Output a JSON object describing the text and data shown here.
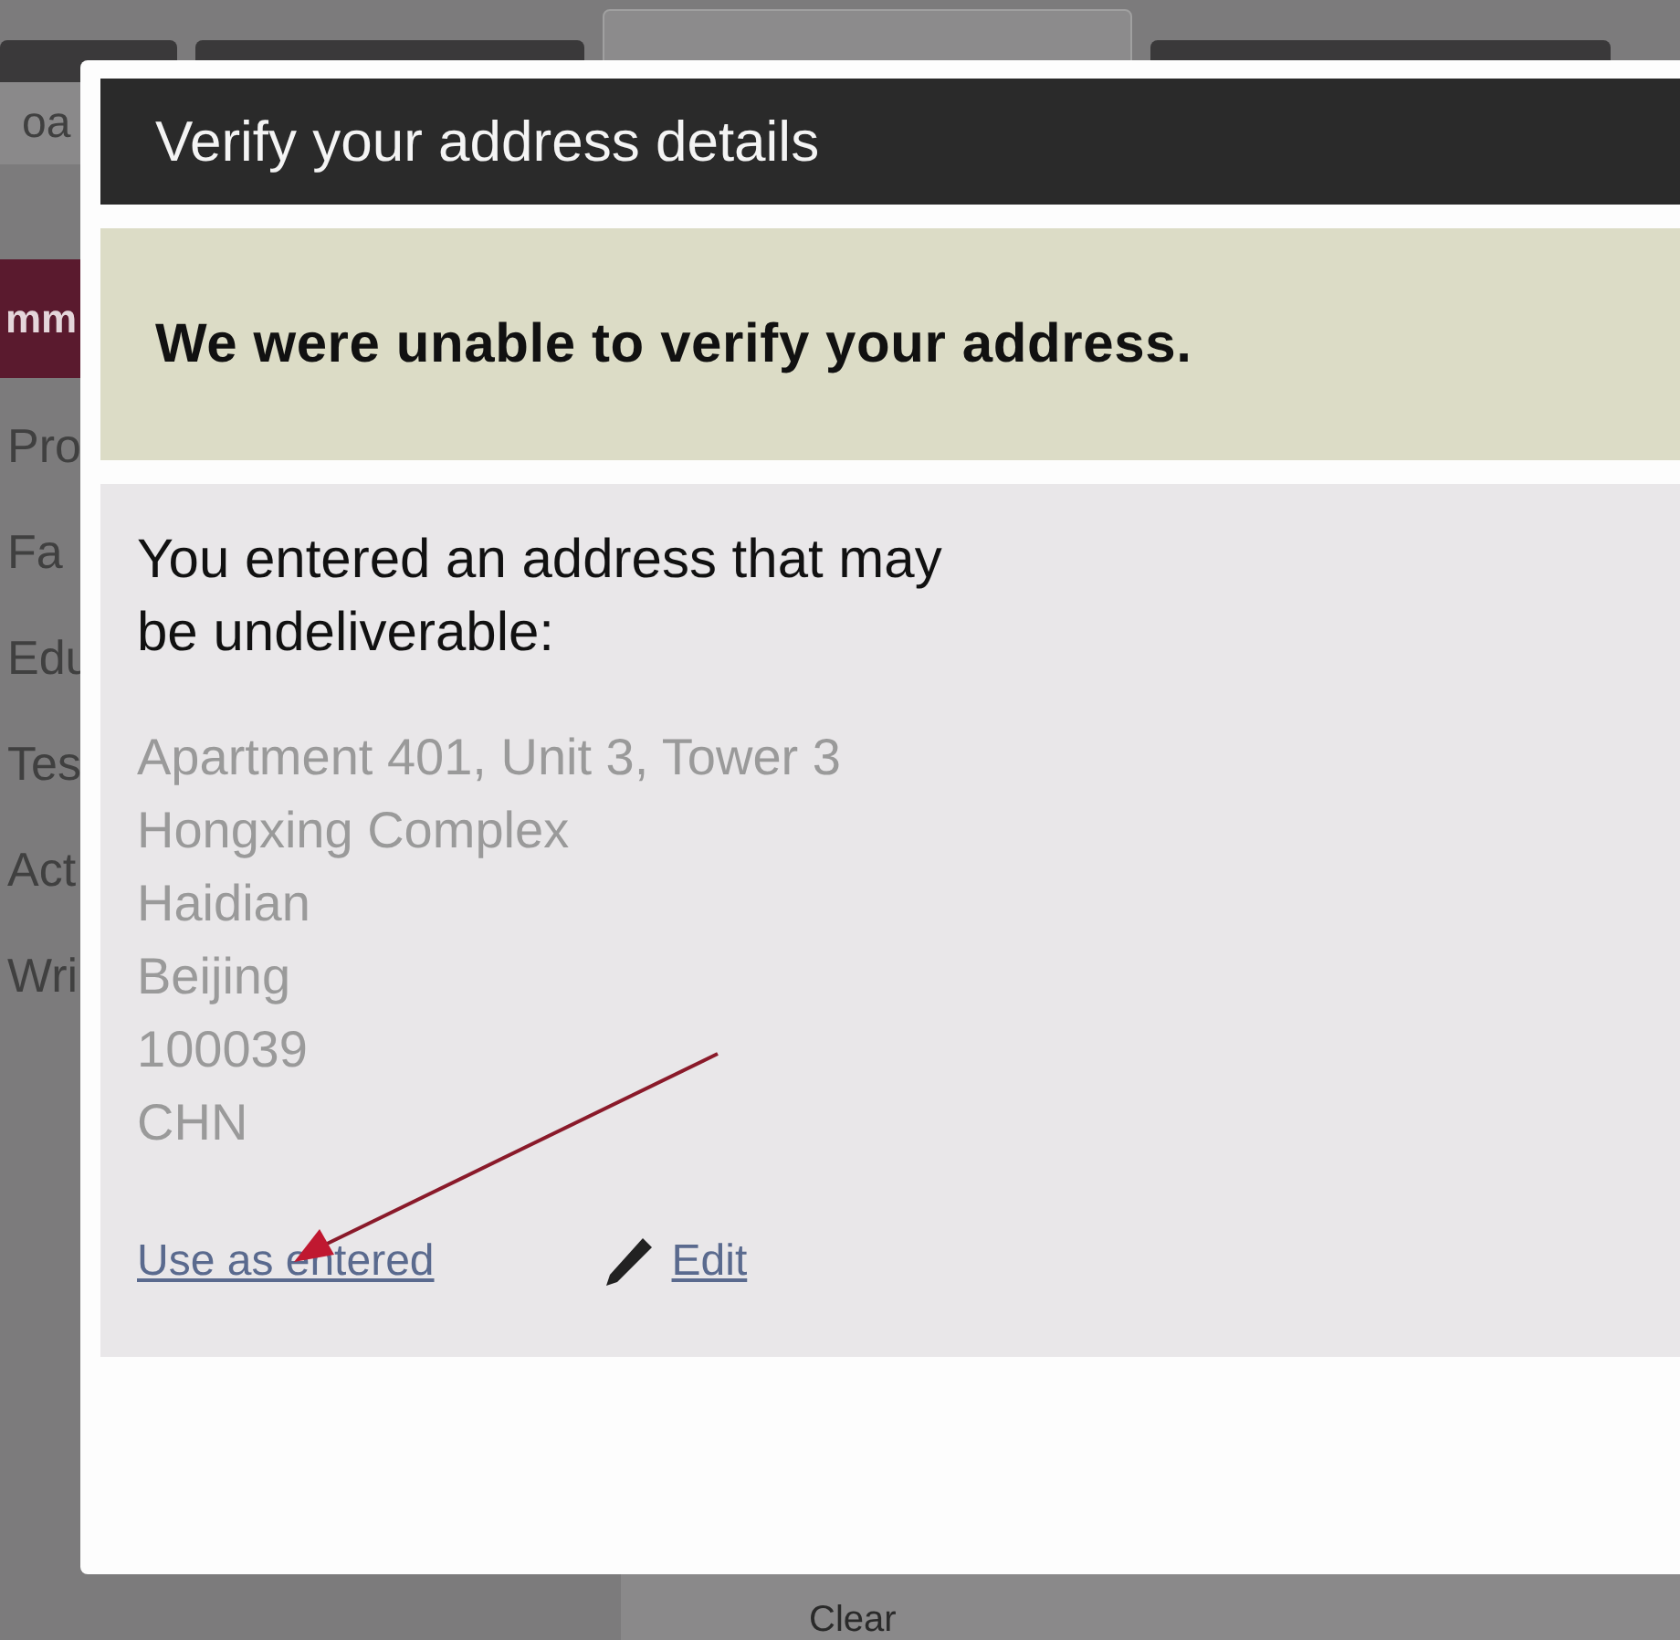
{
  "background": {
    "tabs": [
      {
        "selected": false
      },
      {
        "selected": false
      },
      {
        "selected": true
      },
      {
        "selected": false
      }
    ],
    "heading": "oa",
    "section": "mm",
    "menu": [
      "Pro",
      "Fa",
      "Edu",
      "Tes",
      "Act",
      "Wri"
    ],
    "button": "Clear"
  },
  "dialog": {
    "title": "Verify your address details",
    "alert": "We were unable to verify your address.",
    "message": "You entered an address that may be undeliverable:",
    "address": [
      "Apartment 401, Unit 3, Tower 3",
      "Hongxing Complex",
      "Haidian",
      "Beijing",
      "100039",
      "CHN"
    ],
    "actions": [
      {
        "label": "Use as entered",
        "kind": "link"
      },
      {
        "label": "Edit",
        "kind": "edit"
      }
    ]
  }
}
